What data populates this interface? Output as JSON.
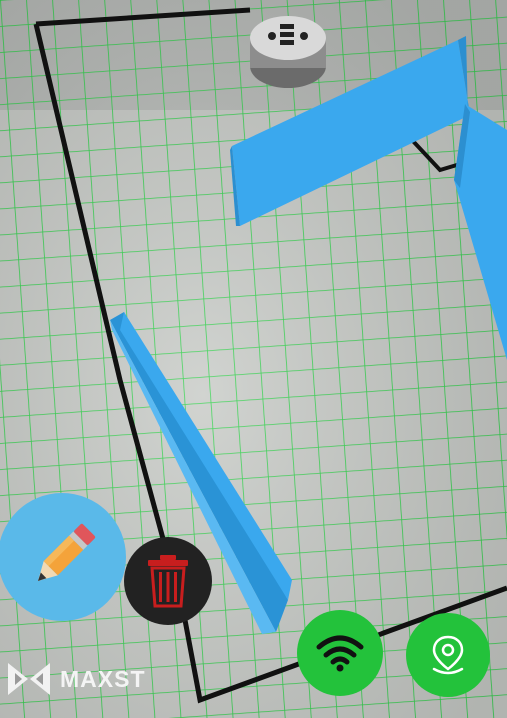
{
  "brand": {
    "name": "MAXST"
  },
  "buttons": {
    "edit": {
      "icon": "pencil-icon"
    },
    "delete": {
      "icon": "trash-icon"
    },
    "wifi": {
      "icon": "wifi-icon"
    },
    "location": {
      "icon": "location-pin-icon"
    }
  },
  "colors": {
    "grid": "#2fd24a",
    "wall": "#37a7ee",
    "edit_button": "#5ab9e9",
    "delete_button": "#222222",
    "delete_icon": "#c81e1e",
    "action_button": "#23c23b"
  }
}
